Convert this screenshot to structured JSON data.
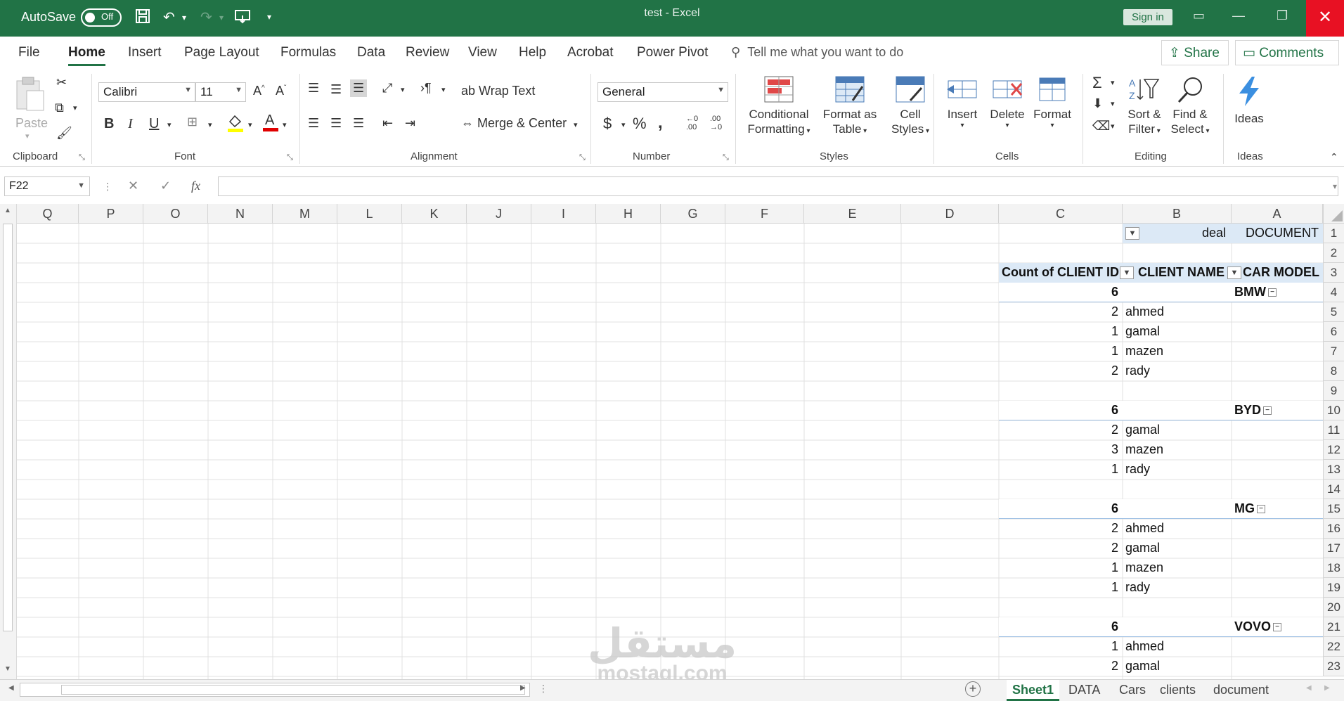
{
  "titlebar": {
    "autosave_label": "AutoSave",
    "autosave_state": "Off",
    "window_title": "test  -  Excel",
    "sign_in": "Sign in"
  },
  "menu": {
    "tabs": [
      "File",
      "Home",
      "Insert",
      "Page Layout",
      "Formulas",
      "Data",
      "Review",
      "View",
      "Help",
      "Acrobat",
      "Power Pivot"
    ],
    "active_tab": "Home",
    "tell_me": "Tell me what you want to do",
    "share": "Share",
    "comments": "Comments"
  },
  "ribbon": {
    "clipboard": {
      "label": "Clipboard",
      "paste": "Paste"
    },
    "font": {
      "label": "Font",
      "name": "Calibri",
      "size": "11"
    },
    "alignment": {
      "label": "Alignment",
      "wrap_text": "Wrap Text",
      "merge_center": "Merge & Center"
    },
    "number": {
      "label": "Number",
      "format": "General"
    },
    "styles": {
      "label": "Styles",
      "conditional_1": "Conditional",
      "conditional_2": "Formatting",
      "format_as_1": "Format as",
      "format_as_2": "Table",
      "cell_styles_1": "Cell",
      "cell_styles_2": "Styles"
    },
    "cells": {
      "label": "Cells",
      "insert": "Insert",
      "delete": "Delete",
      "format": "Format"
    },
    "editing": {
      "label": "Editing",
      "sort_1": "Sort &",
      "sort_2": "Filter",
      "find_1": "Find &",
      "find_2": "Select"
    },
    "ideas": {
      "label": "Ideas",
      "ideas": "Ideas"
    }
  },
  "formula_bar": {
    "name_box": "F22",
    "fx": "fx",
    "value": ""
  },
  "columns": [
    "Q",
    "P",
    "O",
    "N",
    "M",
    "L",
    "K",
    "J",
    "I",
    "H",
    "G",
    "F",
    "E",
    "D",
    "C",
    "B",
    "A"
  ],
  "rows": [
    "1",
    "2",
    "3",
    "4",
    "5",
    "6",
    "7",
    "8",
    "9",
    "10",
    "11",
    "12",
    "13",
    "14",
    "15",
    "16",
    "17",
    "18",
    "19",
    "20",
    "21",
    "22",
    "23"
  ],
  "pivot": {
    "filter_label": "DOCUMENT",
    "filter_value": "deal",
    "header_count": "Count of CLIENT ID",
    "header_client": "CLIENT NAME",
    "header_model": "CAR MODEL",
    "groups": [
      {
        "model": "BMW",
        "total": "6",
        "clients": [
          {
            "name": "ahmed",
            "count": "2"
          },
          {
            "name": "gamal",
            "count": "1"
          },
          {
            "name": "mazen",
            "count": "1"
          },
          {
            "name": "rady",
            "count": "2"
          }
        ]
      },
      {
        "model": "BYD",
        "total": "6",
        "clients": [
          {
            "name": "gamal",
            "count": "2"
          },
          {
            "name": "mazen",
            "count": "3"
          },
          {
            "name": "rady",
            "count": "1"
          }
        ]
      },
      {
        "model": "MG",
        "total": "6",
        "clients": [
          {
            "name": "ahmed",
            "count": "2"
          },
          {
            "name": "gamal",
            "count": "2"
          },
          {
            "name": "mazen",
            "count": "1"
          },
          {
            "name": "rady",
            "count": "1"
          }
        ]
      },
      {
        "model": "VOVO",
        "total": "6",
        "clients": [
          {
            "name": "ahmed",
            "count": "1"
          },
          {
            "name": "gamal",
            "count": "2"
          }
        ]
      }
    ]
  },
  "watermark": {
    "arabic": "مستقل",
    "latin": "mostaql.com"
  },
  "sheets": {
    "tabs": [
      "Sheet1",
      "DATA",
      "Cars",
      "clients",
      "document"
    ],
    "active": "Sheet1"
  }
}
